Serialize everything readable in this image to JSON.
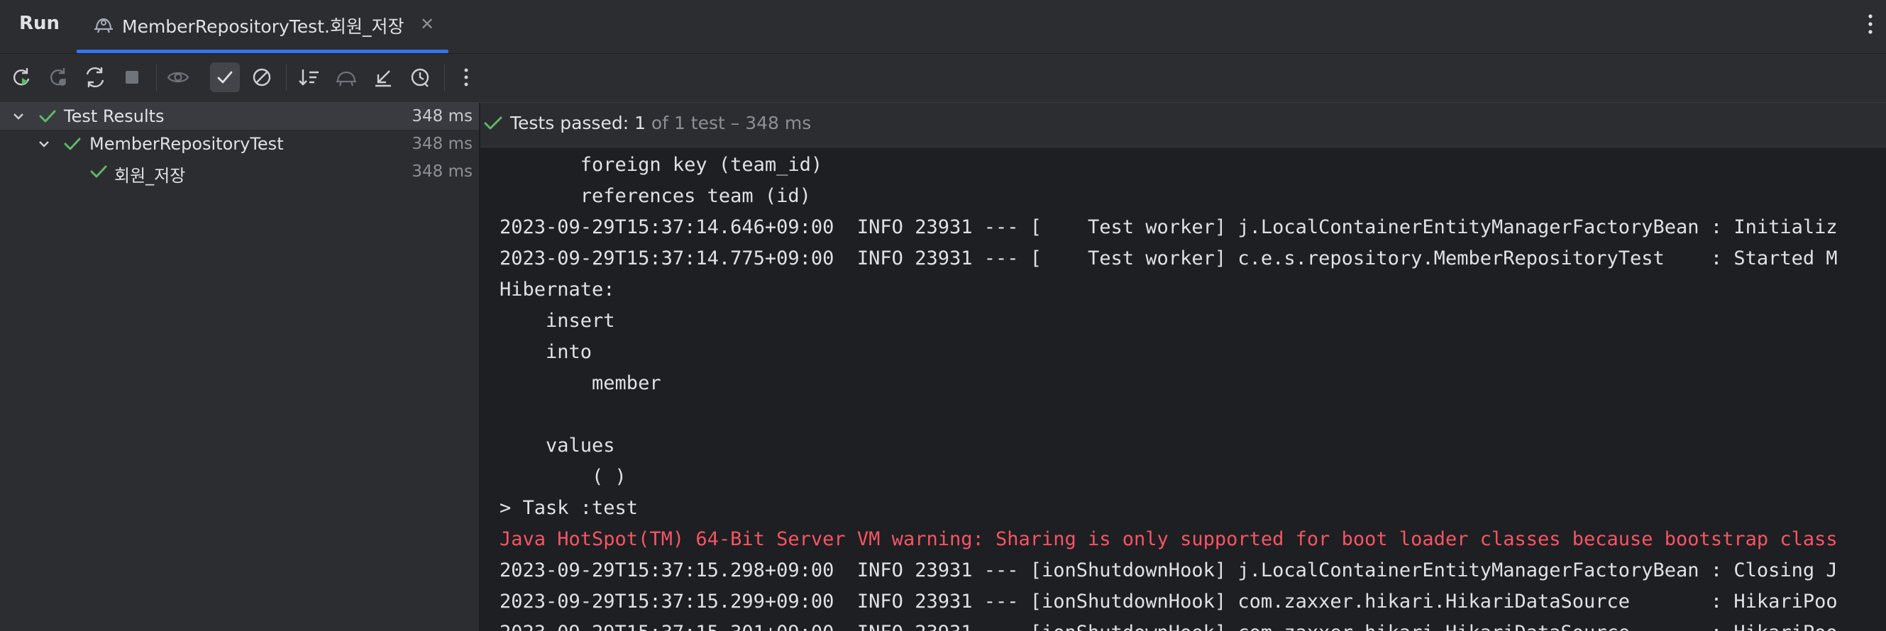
{
  "toolwindow": {
    "title": "Run"
  },
  "tab": {
    "label": "MemberRepositoryTest.회원_저장",
    "close": "✕"
  },
  "tree": {
    "rows": [
      {
        "name": "Test Results",
        "duration": "348 ms"
      },
      {
        "name": "MemberRepositoryTest",
        "duration": "348 ms"
      },
      {
        "name": "회원_저장",
        "duration": "348 ms"
      }
    ]
  },
  "status": {
    "prefix": "Tests passed: ",
    "count": "1",
    "suffix": " of 1 test – 348 ms"
  },
  "console": {
    "lines": [
      "       foreign key (team_id)",
      "       references team (id)",
      "2023-09-29T15:37:14.646+09:00  INFO 23931 --- [    Test worker] j.LocalContainerEntityManagerFactoryBean : Initializ",
      "2023-09-29T15:37:14.775+09:00  INFO 23931 --- [    Test worker] c.e.s.repository.MemberRepositoryTest    : Started M",
      "Hibernate: ",
      "    insert ",
      "    into",
      "        member",
      "",
      "    values",
      "        ( )",
      "> Task :test",
      "Java HotSpot(TM) 64-Bit Server VM warning: Sharing is only supported for boot loader classes because bootstrap class",
      "2023-09-29T15:37:15.298+09:00  INFO 23931 --- [ionShutdownHook] j.LocalContainerEntityManagerFactoryBean : Closing J",
      "2023-09-29T15:37:15.299+09:00  INFO 23931 --- [ionShutdownHook] com.zaxxer.hikari.HikariDataSource       : HikariPoo",
      "2023-09-29T15:37:15.301+09:00  INFO 23931 --- [ionShutdownHook] com.zaxxer.hikari.HikariDataSource       : HikariPoo"
    ]
  },
  "colors": {
    "accent": "#3574f0",
    "pass": "#5fb865",
    "warning_text": "#f75464"
  }
}
